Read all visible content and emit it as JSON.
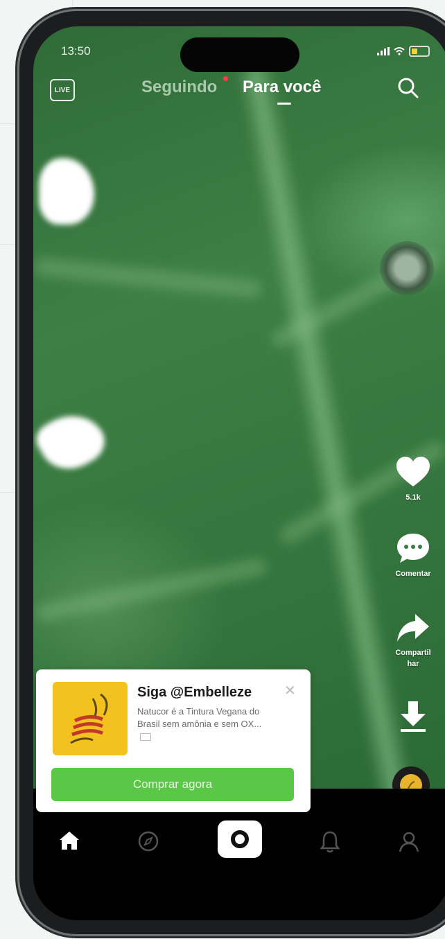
{
  "status_bar": {
    "time": "13:50"
  },
  "top_nav": {
    "live_label": "LIVE",
    "tabs": [
      {
        "label": "Seguindo",
        "active": false,
        "has_notification_dot": true
      },
      {
        "label": "Para você",
        "active": true
      }
    ],
    "search_icon": "search-icon"
  },
  "right_rail": {
    "like": {
      "icon": "heart-icon",
      "count": "5.1k"
    },
    "comment": {
      "icon": "comment-icon",
      "label": "Comentar"
    },
    "share": {
      "icon": "share-arrow-icon",
      "label": "Compartil\nhar"
    },
    "download": {
      "icon": "download-icon"
    },
    "music_disc": {
      "icon": "music-disc-icon"
    }
  },
  "ad": {
    "title": "Siga @Embelleze",
    "description": "Natucor é a Tintura Vegana do Brasil sem amônia e sem OX...",
    "cta_label": "Comprar agora",
    "close_icon": "close-icon",
    "logo_color": "#f4c21f",
    "cta_color": "#5ac747"
  },
  "bottom_nav": {
    "items": [
      {
        "name": "home",
        "icon": "home-icon",
        "active": true
      },
      {
        "name": "discover",
        "icon": "compass-icon"
      },
      {
        "name": "create",
        "icon": "camera-icon"
      },
      {
        "name": "notifications",
        "icon": "bell-icon"
      },
      {
        "name": "profile",
        "icon": "profile-icon"
      }
    ]
  }
}
